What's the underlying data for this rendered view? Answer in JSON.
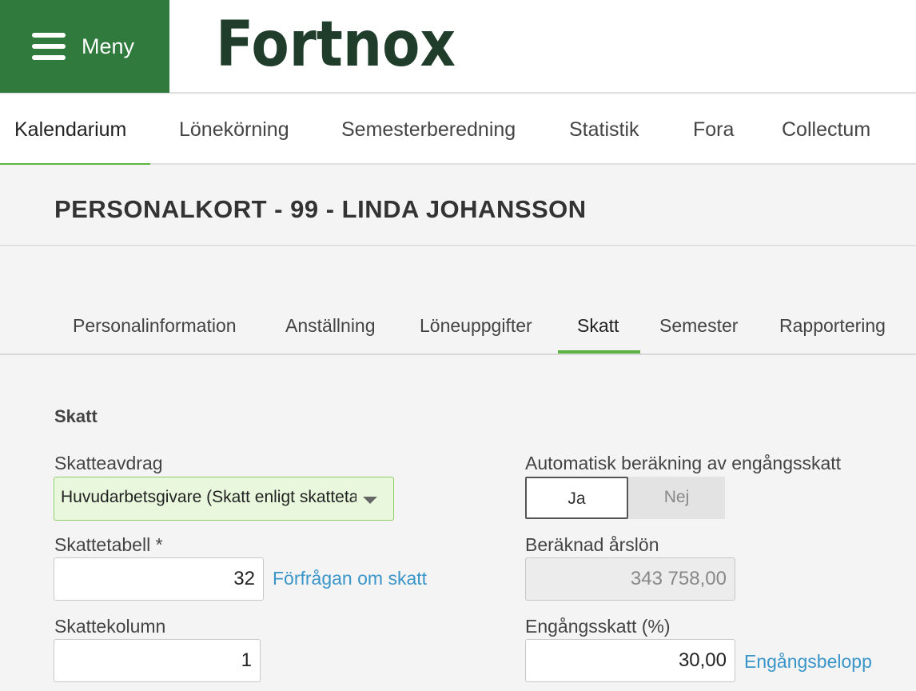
{
  "header": {
    "menu_label": "Meny",
    "logo_text": "Fortnox"
  },
  "main_nav": {
    "tabs": [
      {
        "label": "Kalendarium",
        "active": true
      },
      {
        "label": "Lönekörning",
        "active": false
      },
      {
        "label": "Semesterberedning",
        "active": false
      },
      {
        "label": "Statistik",
        "active": false
      },
      {
        "label": "Fora",
        "active": false
      },
      {
        "label": "Collectum",
        "active": false
      }
    ]
  },
  "page": {
    "title": "PERSONALKORT - 99 - LINDA JOHANSSON"
  },
  "sub_nav": {
    "tabs": [
      {
        "label": "Personalinformation",
        "active": false
      },
      {
        "label": "Anställning",
        "active": false
      },
      {
        "label": "Löneuppgifter",
        "active": false
      },
      {
        "label": "Skatt",
        "active": true
      },
      {
        "label": "Semester",
        "active": false
      },
      {
        "label": "Rapportering",
        "active": false
      }
    ]
  },
  "form": {
    "section_title": "Skatt",
    "skatteavdrag": {
      "label": "Skatteavdrag",
      "value": "Huvudarbetsgivare (Skatt enligt skattetabell)"
    },
    "skattetabell": {
      "label": "Skattetabell *",
      "value": "32",
      "link": "Förfrågan om skatt"
    },
    "skattekolumn": {
      "label": "Skattekolumn",
      "value": "1"
    },
    "auto_engangsskatt": {
      "label": "Automatisk beräkning av engångsskatt",
      "yes": "Ja",
      "no": "Nej",
      "selected": "Ja"
    },
    "beraknad_arslon": {
      "label": "Beräknad årslön",
      "value": "343 758,00"
    },
    "engangsskatt": {
      "label": "Engångsskatt (%)",
      "value": "30,00",
      "link": "Engångsbelopp"
    }
  },
  "colors": {
    "brand_green": "#2f7a3c",
    "accent_green": "#5bb341",
    "logo_dark": "#1f3d2a",
    "link_blue": "#3a95c8"
  }
}
